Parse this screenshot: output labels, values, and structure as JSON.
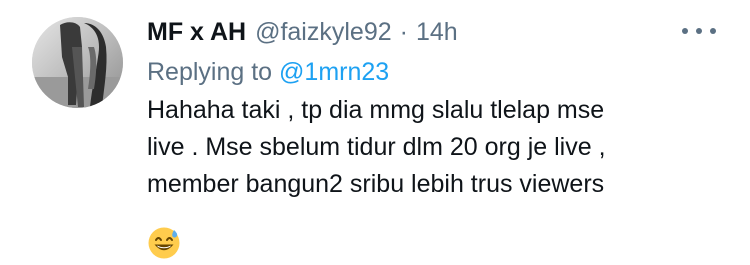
{
  "author": {
    "display_name": "MF x AH",
    "handle": "@faizkyle92",
    "separator": "·",
    "time": "14h"
  },
  "reply": {
    "prefix": "Replying to",
    "handle": "@1mrn23"
  },
  "tweet_lines": [
    "Hahaha taki , tp dia mmg slalu tlelap mse",
    "live . Mse sbelum tidur dlm 20 org je live ,",
    "member bangun2 sribu lebih trus viewers"
  ],
  "emoji": "grinning-face-with-sweat",
  "icons": {
    "more": "more-options-icon"
  },
  "colors": {
    "text": "#0f1419",
    "secondary": "#5b7083",
    "link": "#1da1f2",
    "background": "#ffffff"
  }
}
